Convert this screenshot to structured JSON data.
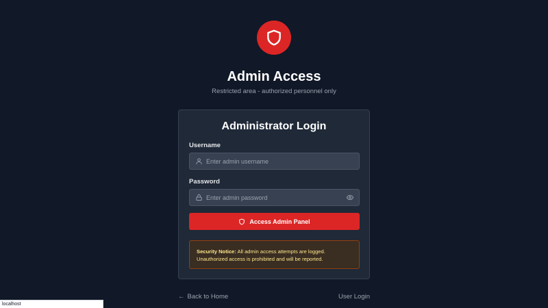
{
  "header": {
    "logo_icon": "shield-icon",
    "title": "Admin Access",
    "subtitle": "Restricted area - authorized personnel only"
  },
  "login_card": {
    "title": "Administrator Login",
    "username": {
      "label": "Username",
      "placeholder": "Enter admin username",
      "value": "",
      "icon": "user-icon"
    },
    "password": {
      "label": "Password",
      "placeholder": "Enter admin password",
      "value": "",
      "icon": "lock-icon",
      "toggle_icon": "eye-icon"
    },
    "submit": {
      "label": "Access Admin Panel",
      "icon": "shield-icon"
    },
    "notice": {
      "heading": "Security Notice:",
      "text": "All admin access attempts are logged. Unauthorized access is prohibited and will be reported."
    }
  },
  "footer": {
    "back_arrow": "←",
    "back_label": "Back to Home",
    "user_login_label": "User Login"
  },
  "status_bar": {
    "url": "localhost"
  },
  "colors": {
    "background": "#111827",
    "card": "#1f2937",
    "accent": "#dc2626",
    "notice_border": "#92400e",
    "notice_text": "#fde68a"
  }
}
